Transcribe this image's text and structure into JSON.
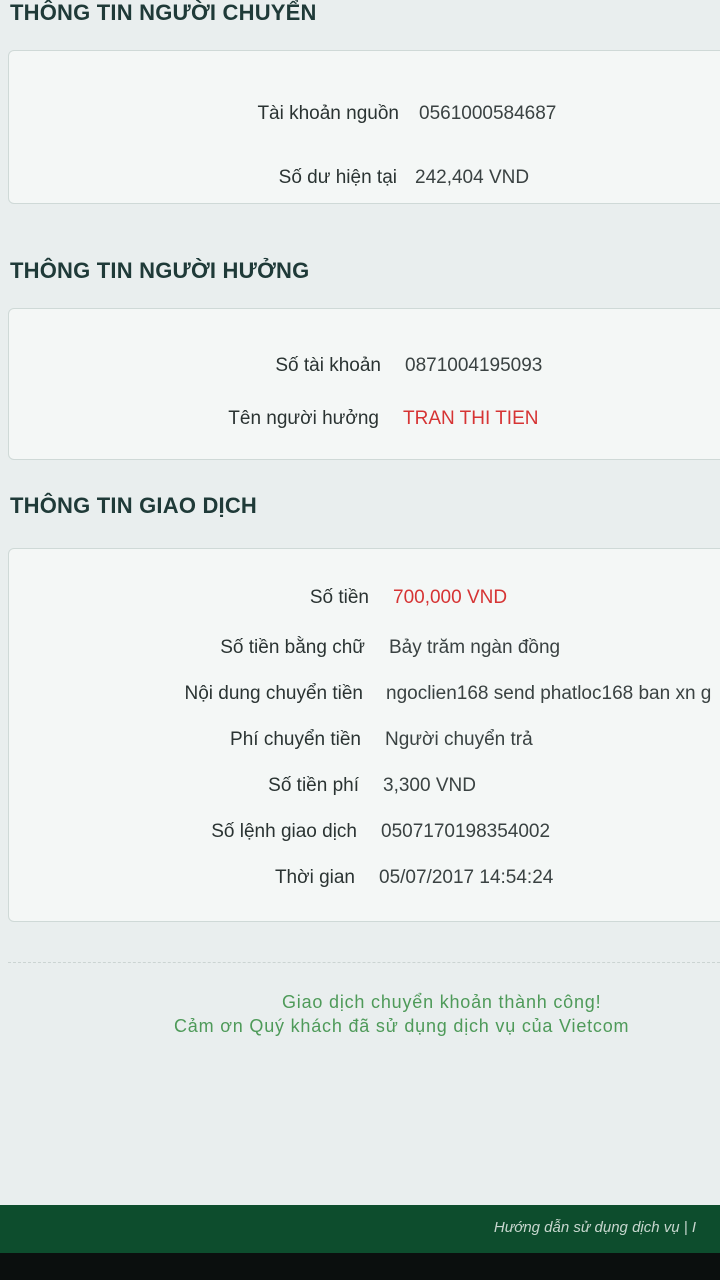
{
  "sender": {
    "title": "THÔNG TIN NGƯỜI CHUYỂN",
    "rows": [
      {
        "label": "Tài khoản nguồn",
        "value": "0561000584687"
      },
      {
        "label": "Số dư hiện tại",
        "value": "242,404 VND"
      }
    ]
  },
  "beneficiary": {
    "title": "THÔNG TIN NGƯỜI HƯỞNG",
    "rows": [
      {
        "label": "Số tài khoản",
        "value": "0871004195093"
      },
      {
        "label": "Tên người hưởng",
        "value": "TRAN THI TIEN"
      }
    ]
  },
  "transaction": {
    "title": "THÔNG TIN GIAO DỊCH",
    "rows": [
      {
        "label": "Số tiền",
        "value": "700,000 VND"
      },
      {
        "label": "Số tiền bằng chữ",
        "value": "Bảy trăm ngàn đồng"
      },
      {
        "label": "Nội dung chuyển tiền",
        "value": "ngoclien168 send phatloc168 ban xn g"
      },
      {
        "label": "Phí chuyển tiền",
        "value": "Người chuyển trả"
      },
      {
        "label": "Số tiền phí",
        "value": "3,300 VND"
      },
      {
        "label": "Số lệnh giao dịch",
        "value": "0507170198354002"
      },
      {
        "label": "Thời gian",
        "value": "05/07/2017 14:54:24"
      }
    ]
  },
  "result": {
    "line1": "Giao dịch chuyển khoản thành công!",
    "line2": "Cảm ơn Quý khách đã sử dụng dịch vụ của Vietcom"
  },
  "footer": {
    "link": "Hướng dẫn sử dụng dịch vụ | I"
  },
  "colors": {
    "highlight_red": "#d63434",
    "success_green": "#4e9a59",
    "footer_green": "#0d4d2d"
  }
}
